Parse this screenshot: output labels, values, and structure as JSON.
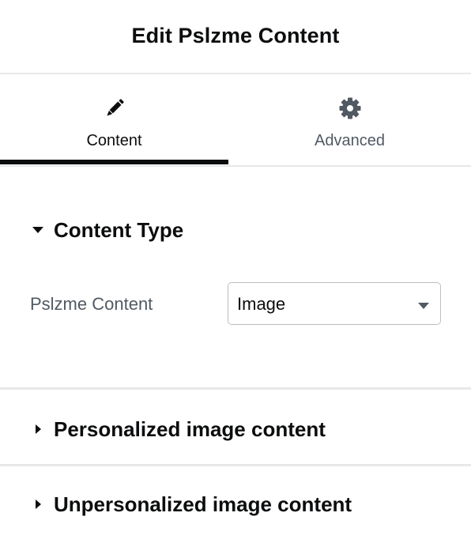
{
  "header": {
    "title": "Edit Pslzme Content"
  },
  "tabs": [
    {
      "label": "Content",
      "icon": "pencil-icon",
      "active": true
    },
    {
      "label": "Advanced",
      "icon": "gear-icon",
      "active": false
    }
  ],
  "sections": {
    "content_type": {
      "title": "Content Type",
      "expanded": true,
      "field": {
        "label": "Pslzme Content",
        "selected_value": "Image"
      }
    },
    "personalized": {
      "title": "Personalized image content",
      "expanded": false
    },
    "unpersonalized": {
      "title": "Unpersonalized image content",
      "expanded": false
    }
  },
  "colors": {
    "text": "#0c0d0e",
    "muted": "#515962",
    "divider": "#e6e8ea",
    "select_border": "#babfc5",
    "icon": "#515962"
  }
}
